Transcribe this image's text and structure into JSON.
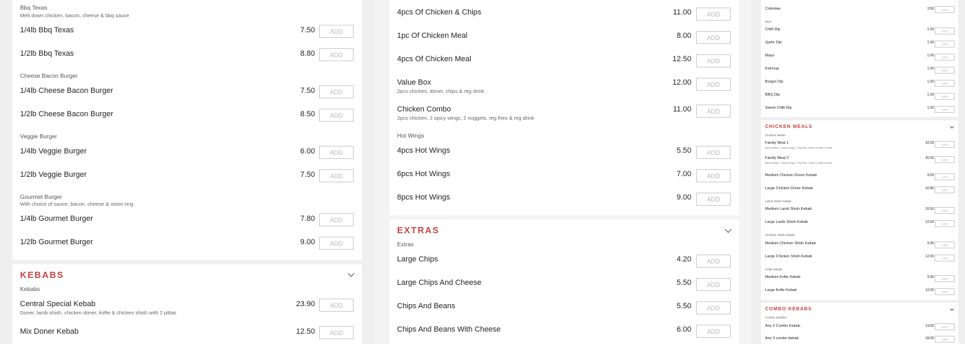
{
  "add_label": "ADD",
  "col1": {
    "top_group": {
      "title": "Bbq Texas",
      "desc": "Melt down chicken, bacon, cheese & bbq sauce"
    },
    "top_items": [
      {
        "name": "1/4lb Bbq Texas",
        "price": "7.50"
      },
      {
        "name": "1/2lb Bbq Texas",
        "price": "8.80"
      }
    ],
    "groups": [
      {
        "title": "Cheese Bacon Burger",
        "desc": "",
        "items": [
          {
            "name": "1/4lb Cheese Bacon Burger",
            "price": "7.50"
          },
          {
            "name": "1/2lb Cheese Bacon Burger",
            "price": "8.50"
          }
        ]
      },
      {
        "title": "Veggie Burger",
        "desc": "",
        "items": [
          {
            "name": "1/4lb Veggie Burger",
            "price": "6.00"
          },
          {
            "name": "1/2lb Veggie Burger",
            "price": "7.50"
          }
        ]
      },
      {
        "title": "Gourmet Burger",
        "desc": "With choice of sauce, bacon, cheese & onion ring",
        "items": [
          {
            "name": "1/4lb Gourmet Burger",
            "price": "7.80"
          },
          {
            "name": "1/2lb Gourmet Burger",
            "price": "9.00"
          }
        ]
      }
    ],
    "kebabs": {
      "title": "KEBABS",
      "group": "Kebabs",
      "items": [
        {
          "name": "Central Special Kebab",
          "desc": "Doner, lamb shish, chicken doner, kofte & chicken shish with 2 pittas",
          "price": "23.90"
        },
        {
          "name": "Mix Doner Kebab",
          "desc": "",
          "price": "12.50"
        }
      ]
    }
  },
  "col2": {
    "top_items": [
      {
        "name": "4pcs Of Chicken & Chips",
        "desc": "",
        "price": "11.00"
      },
      {
        "name": "1pc Of Chicken Meal",
        "desc": "",
        "price": "8.00"
      },
      {
        "name": "4pcs Of Chicken Meal",
        "desc": "",
        "price": "12.50"
      },
      {
        "name": "Value Box",
        "desc": "2pcs chicken, doner, chips & reg drink",
        "price": "12.00"
      },
      {
        "name": "Chicken Combo",
        "desc": "2pcs chicken, 2 spicy wings, 2 nuggets, reg fries & reg drink",
        "price": "11.00"
      }
    ],
    "wings_group": "Hot Wings",
    "wings": [
      {
        "name": "4pcs Hot Wings",
        "price": "5.50"
      },
      {
        "name": "6pcs Hot Wings",
        "price": "7.00"
      },
      {
        "name": "8pcs Hot Wings",
        "price": "9.00"
      }
    ],
    "extras": {
      "title": "EXTRAS",
      "group": "Extras",
      "items": [
        {
          "name": "Large Chips",
          "price": "4.20"
        },
        {
          "name": "Large Chips And Cheese",
          "price": "5.50"
        },
        {
          "name": "Chips And Beans",
          "price": "5.50"
        },
        {
          "name": "Chips And Beans With Cheese",
          "price": "6.00"
        }
      ]
    }
  },
  "col3": {
    "coleslaw": {
      "name": "Coleslaw",
      "price": "3.50"
    },
    "dips_group": "Dips",
    "dips": [
      {
        "name": "Chilli Dip",
        "price": "1.00"
      },
      {
        "name": "Garlic Dip",
        "price": "1.00"
      },
      {
        "name": "Mayo",
        "price": "1.00"
      },
      {
        "name": "Ketchup",
        "price": "1.00"
      },
      {
        "name": "Burger Dip",
        "price": "1.00"
      },
      {
        "name": "BBQ Dip",
        "price": "1.00"
      },
      {
        "name": "Sweet Chilli Dip",
        "price": "1.00"
      }
    ],
    "chicken_meals": {
      "title": "CHICKEN MEALS",
      "group": "Chicken Meals",
      "family": [
        {
          "name": "Family Meal 1",
          "desc": "5pcs chicken, 4 spicy wings, 2 reg fries, beans & bottle of drink",
          "price": "22.50"
        },
        {
          "name": "Family Meal 2",
          "desc": "8pcs chicken, 4 spicy wings, 2 reg fries, 2 dips & bottle of drink",
          "price": "26.50"
        }
      ],
      "doner": [
        {
          "name": "Medium Chicken Doner Kebab",
          "price": "9.50"
        },
        {
          "name": "Large Chicken Doner Kebab",
          "price": "10.80"
        }
      ],
      "lamb_group": "Lamb Shish Kebab",
      "lamb": [
        {
          "name": "Medium Lamb Shish Kebab",
          "price": "10.50"
        },
        {
          "name": "Large Lamb Shish Kebab",
          "price": "12.50"
        }
      ],
      "chshish_group": "Chicken Shish Kebab",
      "chshish": [
        {
          "name": "Medium Chicken Shish Kebab",
          "price": "9.90"
        },
        {
          "name": "Large Chicken Shish Kebab",
          "price": "12.00"
        }
      ],
      "kofte_group": "Kofte Kebab",
      "kofte": [
        {
          "name": "Medium Kofte Kebab",
          "price": "9.90"
        },
        {
          "name": "Large Kofte Kebab",
          "price": "12.00"
        }
      ]
    },
    "combo": {
      "title": "COMBO KEBABS",
      "group": "Combo Kebabs",
      "items": [
        {
          "name": "Any 2 Combo Kebab",
          "price": "13.00"
        },
        {
          "name": "Any 3 combo kebab",
          "price": "18.00"
        }
      ]
    }
  }
}
